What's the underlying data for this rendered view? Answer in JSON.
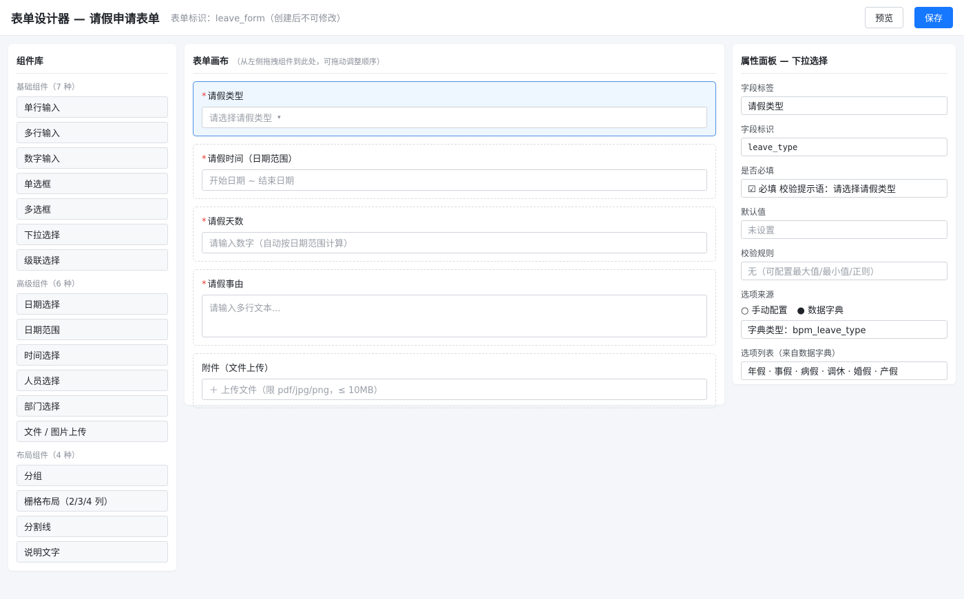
{
  "header": {
    "title": "表单设计器 — 请假申请表单",
    "form_id": "表单标识：leave_form（创建后不可修改）",
    "preview_label": "预览",
    "save_label": "保存"
  },
  "library": {
    "title": "组件库",
    "groups": [
      {
        "label": "基础组件（7 种）",
        "items": [
          "单行输入",
          "多行输入",
          "数字输入",
          "单选框",
          "多选框",
          "下拉选择",
          "级联选择"
        ]
      },
      {
        "label": "高级组件（6 种）",
        "items": [
          "日期选择",
          "日期范围",
          "时间选择",
          "人员选择",
          "部门选择",
          "文件 / 图片上传"
        ]
      },
      {
        "label": "布局组件（4 种）",
        "items": [
          "分组",
          "栅格布局（2/3/4 列）",
          "分割线",
          "说明文字"
        ]
      }
    ]
  },
  "canvas": {
    "title": "表单画布",
    "hint": "（从左侧拖拽组件到此处，可拖动调整顺序）",
    "fields": [
      {
        "label": "请假类型",
        "required": true,
        "placeholder": "请选择请假类型",
        "caret": "▾"
      },
      {
        "label": "请假时间（日期范围）",
        "required": true,
        "placeholder": "开始日期 ~ 结束日期"
      },
      {
        "label": "请假天数",
        "required": true,
        "placeholder": "请输入数字（自动按日期范围计算）"
      },
      {
        "label": "请假事由",
        "required": true,
        "placeholder": "请输入多行文本..."
      },
      {
        "label": "附件（文件上传）",
        "required": false,
        "placeholder": "＋ 上传文件（限 pdf/jpg/png，≤ 10MB）"
      }
    ],
    "required_mark": "*"
  },
  "props": {
    "title": "属性面板 — 下拉选择",
    "field_label_label": "字段标签",
    "field_label_value": "请假类型",
    "field_id_label": "字段标识",
    "field_id_value": "leave_type",
    "required_label": "是否必填",
    "required_value": "☑ 必填    校验提示语：请选择请假类型",
    "default_label": "默认值",
    "default_value": "未设置",
    "rule_label": "校验规则",
    "rule_value": "无（可配置最大值/最小值/正则）",
    "source_label": "选项来源",
    "source_manual": "○ 手动配置",
    "source_dict": "● 数据字典",
    "dict_type": "字典类型：bpm_leave_type",
    "options_label": "选项列表（来自数据字典）",
    "options_value": "年假 · 事假 · 病假 · 调休 · 婚假 · 产假"
  },
  "colors": {
    "primary": "#1677ff",
    "required": "#e53935",
    "selected_bg": "#eef6ff",
    "selected_border": "#4a90e2"
  }
}
